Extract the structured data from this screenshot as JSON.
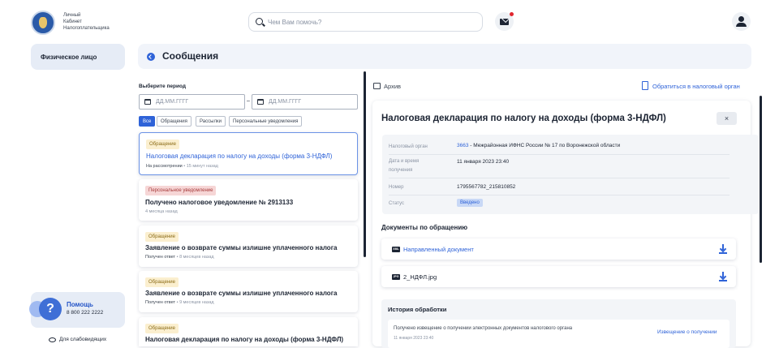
{
  "header": {
    "logo_text_lines": [
      "Личный",
      "Кабинет",
      "Налогоплательщика"
    ],
    "search_placeholder": "Чем Вам помочь?",
    "mail_icon": "mail-icon",
    "user_icon": "user-icon"
  },
  "sidebar": {
    "active_tab": "Физическое лицо",
    "help_title": "Помощь",
    "help_phone": "8 800 222 2222",
    "accessibility": "Для слабовидящих"
  },
  "page": {
    "title": "Сообщения"
  },
  "filters": {
    "period_label": "Выберите период",
    "date_placeholder": "ДД.ММ.ГГГГ",
    "chips": [
      "Все",
      "Обращения",
      "Рассылки",
      "Персональные уведомления"
    ]
  },
  "messages": [
    {
      "badge": "Обращение",
      "title": "Налоговая декларация по налогу на доходы (форма 3-НДФЛ)",
      "status": "На рассмотрении",
      "time": "15 минут назад"
    },
    {
      "badge": "Персональное уведомление",
      "title": "Получено налоговое уведомление № 2913133",
      "status": "",
      "time": "4 месяца назад"
    },
    {
      "badge": "Обращение",
      "title": "Заявление о возврате суммы излишне уплаченного налога",
      "status": "Получен ответ",
      "time": "8 месяцев назад"
    },
    {
      "badge": "Обращение",
      "title": "Заявление о возврате суммы излишне уплаченного налога",
      "status": "Получен ответ",
      "time": "9 месяцев назад"
    },
    {
      "badge": "Обращение",
      "title": "Налоговая декларация по налогу на доходы (форма 3-НДФЛ)",
      "status": "",
      "time": ""
    }
  ],
  "right": {
    "archive_label": "Архив",
    "contact_label": "Обратиться в налоговый орган",
    "detail": {
      "title": "Налоговая декларация по налогу на доходы (форма 3-НДФЛ)",
      "close": "×",
      "tax_authority_label": "Налоговый орган",
      "tax_authority_code": "3663",
      "tax_authority_name": " - Межрайонная ИФНС России № 17 по Воронежской области",
      "date_label_1": "Дата и время",
      "date_label_2": "получения",
      "date_value": "11 января 2023 23:40",
      "number_label": "Номер",
      "number_value": "1795567782_215810852",
      "status_label": "Статус",
      "status_value": "Введено",
      "docs_title": "Документы по обращению",
      "documents": [
        {
          "type": "XML",
          "name": "Направленный документ"
        },
        {
          "type": "JPG",
          "name": "2_НДФЛ.jpg"
        }
      ],
      "history_title": "История обработки",
      "history": [
        {
          "text": "Получено извещение о получении электронных документов налогового органа",
          "time": "11 января 2023 23:40",
          "link": "Извещение о получении"
        }
      ]
    }
  }
}
